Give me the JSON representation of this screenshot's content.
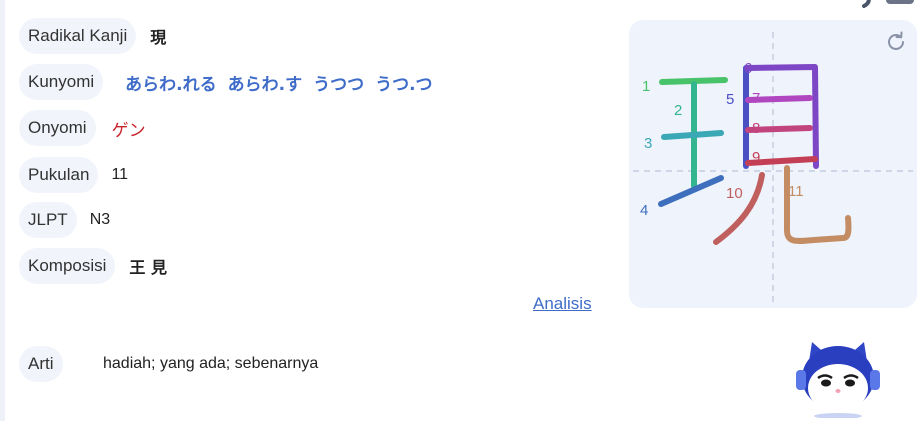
{
  "labels": {
    "radical": "Radikal Kanji",
    "kunyomi": "Kunyomi",
    "onyomi": "Onyomi",
    "strokes": "Pukulan",
    "jlpt": "JLPT",
    "composition": "Komposisi",
    "meaning": "Arti"
  },
  "values": {
    "radical": "現",
    "kunyomi": [
      "あらわ.れる",
      "あらわ.す",
      "うつつ",
      "うつ.つ"
    ],
    "onyomi": "ゲン",
    "strokes": "11",
    "jlpt": "N3",
    "composition": "王 見",
    "meaning": "hadiah; yang ada; sebenarnya"
  },
  "link": {
    "analysis": "Analisis"
  },
  "stroke_diagram": {
    "numbers": [
      "1",
      "2",
      "3",
      "4",
      "5",
      "6",
      "7",
      "8",
      "9",
      "10",
      "11"
    ],
    "colors": [
      "#49c36a",
      "#33b58f",
      "#3aa9b5",
      "#3d6fbd",
      "#4a4fc4",
      "#7c46c4",
      "#b147c0",
      "#c1447f",
      "#c33f55",
      "#c0605e",
      "#c48c63"
    ],
    "reload_icon": "reload-icon"
  },
  "colors": {
    "accent": "#3e6cc8",
    "onyomi": "#c8262e",
    "pill_bg": "#f1f4fa",
    "card_bg": "#eef3fc"
  }
}
